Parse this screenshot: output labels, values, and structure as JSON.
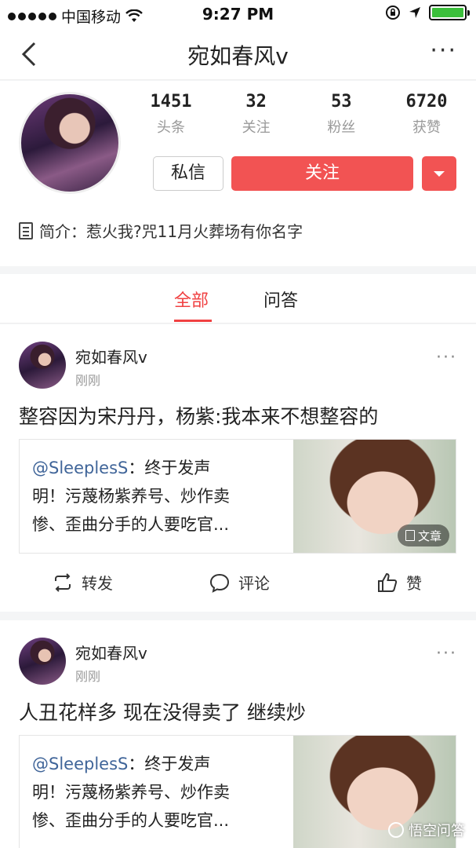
{
  "status_bar": {
    "carrier": "中国移动",
    "time": "9:27 PM",
    "battery_level": 1.0,
    "icons": [
      "signal-dots-icon",
      "wifi-icon",
      "rotation-lock-icon",
      "location-arrow-icon",
      "battery-icon"
    ]
  },
  "nav": {
    "title": "宛如春风v",
    "more": "···"
  },
  "profile": {
    "stats": [
      {
        "num": "1451",
        "label": "头条"
      },
      {
        "num": "32",
        "label": "关注"
      },
      {
        "num": "53",
        "label": "粉丝"
      },
      {
        "num": "6720",
        "label": "获赞"
      }
    ],
    "message_label": "私信",
    "follow_label": "关注",
    "bio": "简介：惹火我?咒11月火葬场有你名字"
  },
  "tabs": [
    {
      "label": "全部",
      "active": true
    },
    {
      "label": "问答",
      "active": false
    }
  ],
  "posts": [
    {
      "author": "宛如春风v",
      "time": "刚刚",
      "text": "整容因为宋丹丹，杨紫:我本来不想整容的",
      "card": {
        "mention": "@SleeplesS",
        "line1": "：终于发声",
        "line2": "明！污蔑杨紫养号、炒作卖",
        "line3": "惨、歪曲分手的人要吃官...",
        "badge": "文章"
      },
      "actions": {
        "repost": "转发",
        "comment": "评论",
        "like": "赞"
      }
    },
    {
      "author": "宛如春风v",
      "time": "刚刚",
      "text": "人丑花样多 现在没得卖了 继续炒",
      "card": {
        "mention": "@SleeplesS",
        "line1": "：终于发声",
        "line2": "明！污蔑杨紫养号、炒作卖",
        "line3": "惨、歪曲分手的人要吃官..."
      }
    }
  ],
  "watermark": "悟空问答",
  "colors": {
    "accent": "#f25353",
    "tab_active": "#f04142",
    "mention": "#406599"
  }
}
